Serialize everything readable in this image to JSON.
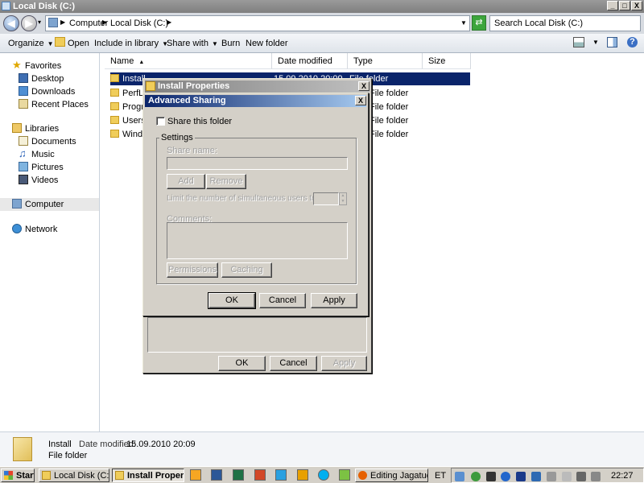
{
  "window": {
    "title": "Local Disk (C:)",
    "caption_buttons": [
      "_",
      "□",
      "X"
    ]
  },
  "address": {
    "segments": [
      "Computer",
      "Local Disk (C:)"
    ],
    "search_placeholder": "Search Local Disk (C:)"
  },
  "toolbar": {
    "organize": "Organize",
    "open": "Open",
    "include_in_library": "Include in library",
    "share_with": "Share with",
    "burn": "Burn",
    "new_folder": "New folder"
  },
  "nav": {
    "favorites": "Favorites",
    "desktop": "Desktop",
    "downloads": "Downloads",
    "recent_places": "Recent Places",
    "libraries": "Libraries",
    "documents": "Documents",
    "music": "Music",
    "pictures": "Pictures",
    "videos": "Videos",
    "computer": "Computer",
    "network": "Network"
  },
  "columns": {
    "name": "Name",
    "date_modified": "Date modified",
    "type": "Type",
    "size": "Size"
  },
  "files": [
    {
      "name": "Install",
      "date": "15.09.2010 20:09",
      "type": "File folder"
    },
    {
      "name": "PerfLogs",
      "type": "File folder"
    },
    {
      "name": "Program Files",
      "type": "File folder"
    },
    {
      "name": "Users",
      "type": "File folder"
    },
    {
      "name": "Windows",
      "type": "File folder"
    }
  ],
  "visible_names": [
    "Install",
    "PerfLo",
    "Progra",
    "Users",
    "Windo"
  ],
  "details": {
    "name": "Install",
    "date_label": "Date modified:",
    "date_value": "15.09.2010 20:09",
    "type": "File folder"
  },
  "install_properties": {
    "title": "Install Properties",
    "ok": "OK",
    "cancel": "Cancel",
    "apply": "Apply"
  },
  "advanced_sharing": {
    "title": "Advanced Sharing",
    "share_checkbox_label": "Share this folder",
    "share_checked": false,
    "settings_group": "Settings",
    "share_name_label": "Share name:",
    "add": "Add",
    "remove": "Remove",
    "limit_label": "Limit the number of simultaneous users to:",
    "comments_label": "Comments:",
    "permissions": "Permissions",
    "caching": "Caching",
    "ok": "OK",
    "cancel": "Cancel",
    "apply": "Apply"
  },
  "taskbar": {
    "start": "Start",
    "tasks": [
      "Local Disk (C:)",
      "Install Proper...",
      "Editing Jagatud..."
    ],
    "language": "ET",
    "clock": "22:27"
  },
  "colors": {
    "selection": "#0a246a",
    "dialog_face": "#d4d0c8",
    "title_active_start": "#0a246a",
    "title_active_end": "#a6caf0",
    "title_inactive_start": "#808080",
    "title_inactive_end": "#c0c0c0"
  }
}
